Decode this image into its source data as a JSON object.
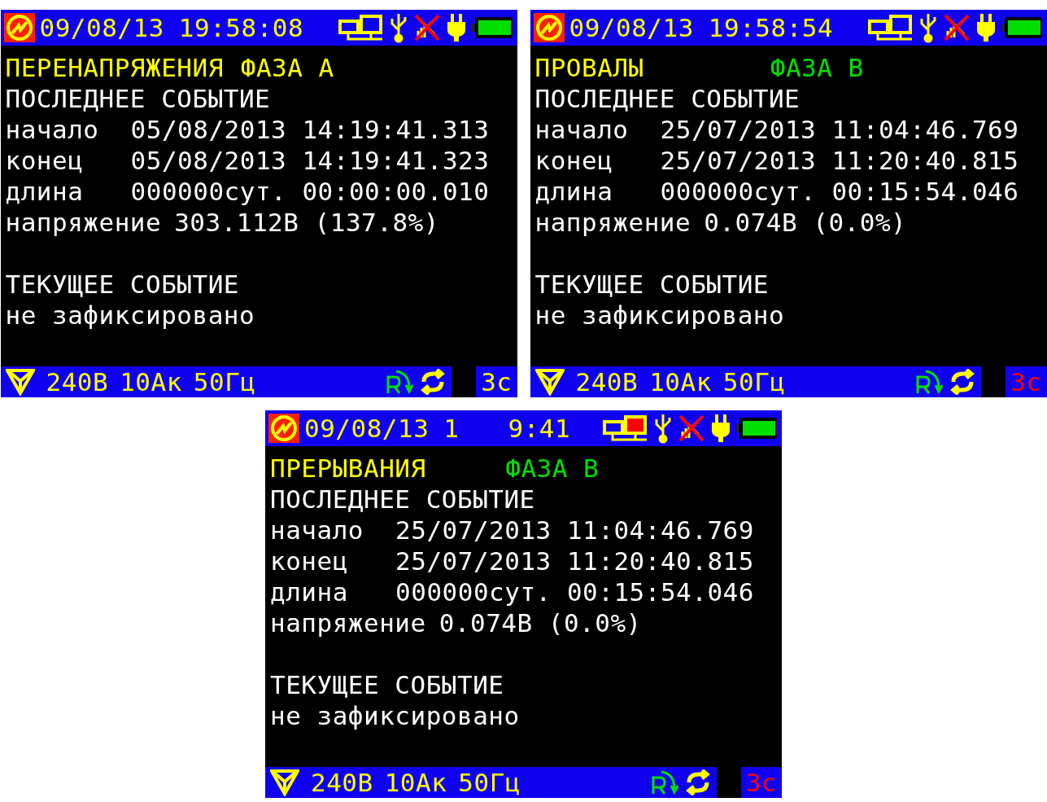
{
  "screens": [
    {
      "status": {
        "date": "09/08/13",
        "time_parts": [
          "19:58:08"
        ],
        "pc_alert": false
      },
      "title": "ПЕРЕНАПРЯЖЕНИЯ",
      "phase": {
        "text": "ФАЗА А",
        "color": "#ffff00"
      },
      "last_heading": "ПОСЛЕДНЕЕ СОБЫТИЕ",
      "fields": [
        {
          "label": "начало",
          "value": "05/08/2013 14:19:41.313"
        },
        {
          "label": "конец",
          "value": "05/08/2013 14:19:41.323"
        },
        {
          "label": "длина",
          "value": "000000сут. 00:00:00.010"
        },
        {
          "label": "напряжение",
          "value": "303.112В (137.8%)"
        }
      ],
      "current_heading": "ТЕКУЩЕЕ СОБЫТИЕ",
      "current_value": "не зафиксировано",
      "footer": {
        "readings": [
          "240В",
          "10Ак",
          "50Гц"
        ],
        "timer": {
          "text": "3с",
          "color": "#ffff00"
        }
      }
    },
    {
      "status": {
        "date": "09/08/13",
        "time_parts": [
          "19:58:54"
        ],
        "pc_alert": false
      },
      "title": "ПРОВАЛЫ",
      "phase": {
        "text": "ФАЗА В",
        "color": "#00e000"
      },
      "last_heading": "ПОСЛЕДНЕЕ СОБЫТИЕ",
      "fields": [
        {
          "label": "начало",
          "value": "25/07/2013 11:04:46.769"
        },
        {
          "label": "конец",
          "value": "25/07/2013 11:20:40.815"
        },
        {
          "label": "длина",
          "value": "000000сут. 00:15:54.046"
        },
        {
          "label": "напряжение",
          "value": "0.074В (0.0%)"
        }
      ],
      "current_heading": "ТЕКУЩЕЕ СОБЫТИЕ",
      "current_value": "не зафиксировано",
      "footer": {
        "readings": [
          "240В",
          "10Ак",
          "50Гц"
        ],
        "timer": {
          "text": "3с",
          "color": "#ff0000"
        }
      }
    },
    {
      "status": {
        "date": "09/08/13",
        "time_parts": [
          "1",
          "9:41"
        ],
        "pc_alert": true
      },
      "title": "ПРЕРЫВАНИЯ",
      "phase": {
        "text": "ФАЗА В",
        "color": "#00e000"
      },
      "last_heading": "ПОСЛЕДНЕЕ СОБЫТИЕ",
      "fields": [
        {
          "label": "начало",
          "value": "25/07/2013 11:04:46.769"
        },
        {
          "label": "конец",
          "value": "25/07/2013 11:20:40.815"
        },
        {
          "label": "длина",
          "value": "000000сут. 00:15:54.046"
        },
        {
          "label": "напряжение",
          "value": "0.074В (0.0%)"
        }
      ],
      "current_heading": "ТЕКУЩЕЕ СОБЫТИЕ",
      "current_value": "не зафиксировано",
      "footer": {
        "readings": [
          "240В",
          "10Ак",
          "50Гц"
        ],
        "timer": {
          "text": "3с",
          "color": "#ff0000"
        }
      }
    }
  ]
}
